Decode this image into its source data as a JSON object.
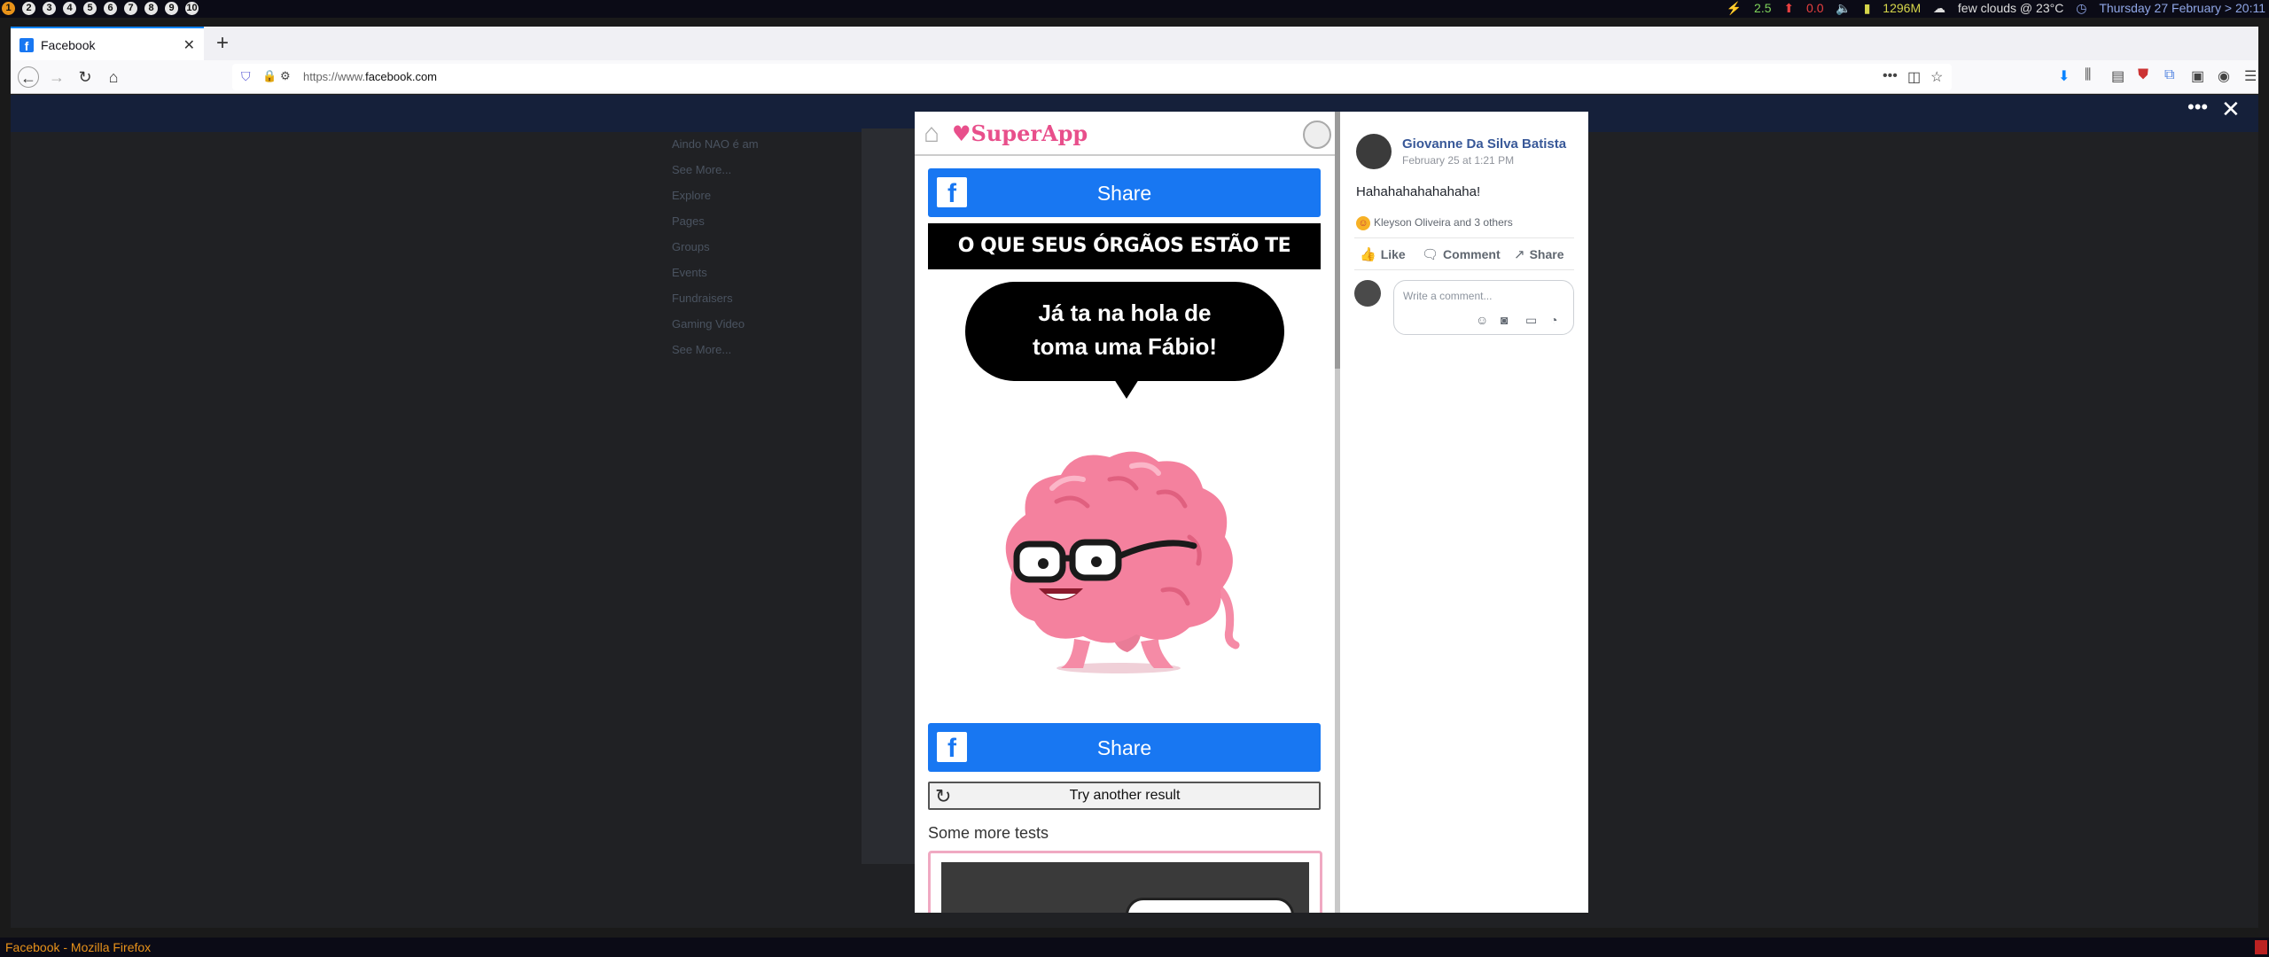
{
  "topbar": {
    "workspaces": [
      "1",
      "2",
      "3",
      "4",
      "5",
      "6",
      "7",
      "8",
      "9",
      "10"
    ],
    "status": {
      "load": "2.5",
      "cpu": "0.0",
      "memory": "1296M",
      "weather": "few clouds @ 23°C",
      "datetime": "Thursday 27 February > 20:11"
    }
  },
  "browser": {
    "tab_title": "Facebook",
    "url_prefix": "https://www.",
    "url_domain": "facebook.com"
  },
  "background_sidebar": [
    "Aindo NAO é am",
    "See More...",
    "Explore",
    "Pages",
    "Groups",
    "Events",
    "Fundraisers",
    "Gaming Video",
    "See More..."
  ],
  "superapp": {
    "logo": "SuperApp",
    "share_label": "Share",
    "headline": "O QUE SEUS ÓRGÃOS ESTÃO TE PEDINDO?",
    "bubble_line1": "Já ta na hola de",
    "bubble_line2": "toma uma Fábio!",
    "try_another": "Try another result",
    "more_tests": "Some more tests"
  },
  "post": {
    "author": "Giovanne Da Silva Batista",
    "date": "February 25 at 1:21 PM",
    "text": "Hahahahahahahaha!",
    "reactions": "Kleyson Oliveira and 3 others",
    "like": "Like",
    "comment": "Comment",
    "share": "Share",
    "comment_placeholder": "Write a comment..."
  },
  "window_title": "Facebook - Mozilla Firefox",
  "colors": {
    "facebook_blue": "#1877f2",
    "superapp_pink": "#e84f8b",
    "link_blue": "#385898"
  }
}
